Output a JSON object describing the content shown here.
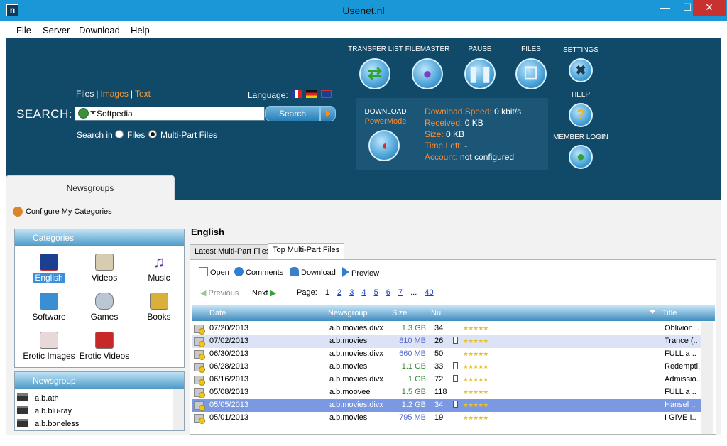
{
  "window": {
    "title": "Usenet.nl",
    "icon": "n"
  },
  "menu": [
    "File",
    "Server",
    "Download",
    "Help"
  ],
  "search": {
    "types": [
      "Files",
      "Images",
      "Text"
    ],
    "language_label": "Language:",
    "label": "SEARCH:",
    "value": "Softpedia",
    "button": "Search",
    "search_in_label": "Search in",
    "options": [
      "Files",
      "Multi-Part Files"
    ],
    "selected": "Multi-Part Files"
  },
  "toolbar": {
    "transfer_list": "TRANSFER LIST",
    "filemaster": "FILEMASTER",
    "pause": "PAUSE",
    "files": "FILES",
    "settings": "SETTINGS",
    "help": "HELP",
    "member_login": "MEMBER LOGIN",
    "download": "DOWNLOAD",
    "powermode": "PowerMode"
  },
  "download_stats": [
    {
      "key": "Download Speed:",
      "value": "0 kbit/s"
    },
    {
      "key": "Received:",
      "value": "0 KB"
    },
    {
      "key": "Size:",
      "value": "0 KB"
    },
    {
      "key": "Time Left:",
      "value": "-"
    },
    {
      "key": "Account:",
      "value": "not configured"
    }
  ],
  "sidebar": {
    "tab": "Newsgroups",
    "configure": "Configure My Categories",
    "categories_head": "Categories",
    "categories": [
      "English",
      "Videos",
      "Music",
      "Software",
      "Games",
      "Books",
      "Erotic Images",
      "Erotic Videos"
    ],
    "selected_category": "English",
    "newsgroup_head": "Newsgroup",
    "newsgroups": [
      "a.b.ath",
      "a.b.blu-ray",
      "a.b.boneless"
    ]
  },
  "main": {
    "title": "English",
    "tabs": [
      "Latest Multi-Part Files",
      "Top Multi-Part Files"
    ],
    "active_tab": "Top Multi-Part Files",
    "actions": [
      "Open",
      "Comments",
      "Download",
      "Preview"
    ],
    "previous": "Previous",
    "next": "Next",
    "page_label": "Page:",
    "pages": [
      "1",
      "2",
      "3",
      "4",
      "5",
      "6",
      "7"
    ],
    "ellipsis": "...",
    "last_page": "40",
    "columns": [
      "Date",
      "Newsgroup",
      "Size",
      "Nu..",
      "Title"
    ],
    "rows": [
      {
        "date": "07/20/2013",
        "group": "a.b.movies.divx",
        "size": "1.3 GB",
        "num": "34",
        "stars": "★★★★★",
        "title": "Oblivion ..",
        "info": false,
        "state": "normal"
      },
      {
        "date": "07/02/2013",
        "group": "a.b.movies",
        "size": "810 MB",
        "num": "26",
        "stars": "★★★★★",
        "title": "Trance (..",
        "info": true,
        "state": "alt"
      },
      {
        "date": "06/30/2013",
        "group": "a.b.movies.divx",
        "size": "660 MB",
        "num": "50",
        "stars": "★★★★★",
        "title": "FULL a ..",
        "info": false,
        "state": "normal"
      },
      {
        "date": "06/28/2013",
        "group": "a.b.movies",
        "size": "1.1 GB",
        "num": "33",
        "stars": "★★★★★",
        "title": "Redempti..",
        "info": true,
        "state": "normal"
      },
      {
        "date": "06/16/2013",
        "group": "a.b.movies.divx",
        "size": "1 GB",
        "num": "72",
        "stars": "★★★★★",
        "title": "Admissio..",
        "info": true,
        "state": "normal"
      },
      {
        "date": "05/08/2013",
        "group": "a.b.moovee",
        "size": "1.5 GB",
        "num": "118",
        "stars": "★★★★★",
        "title": "FULL a ..",
        "info": false,
        "state": "normal"
      },
      {
        "date": "05/05/2013",
        "group": "a.b.movies.divx",
        "size": "1.2 GB",
        "num": "34",
        "stars": "★★★★★",
        "title": "Hansel ..",
        "info": true,
        "state": "sel"
      },
      {
        "date": "05/01/2013",
        "group": "a.b.movies",
        "size": "795 MB",
        "num": "19",
        "stars": "★★★★★",
        "title": "I GIVE I..",
        "info": false,
        "state": "normal"
      }
    ]
  },
  "colors": {
    "panel": "#114a69",
    "accent": "#ff8c33",
    "title_bar": "#1a97d6"
  }
}
